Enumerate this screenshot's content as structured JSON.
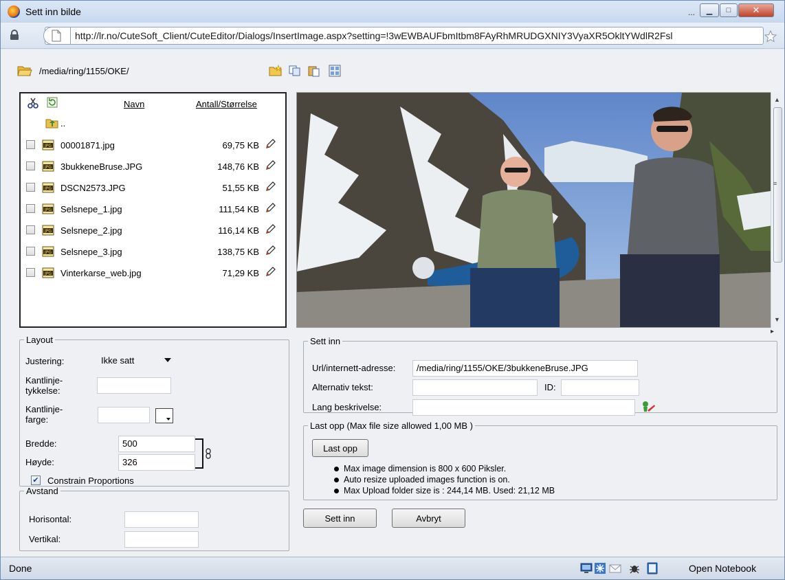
{
  "window": {
    "title": "Sett inn bilde",
    "ellipsis": "..."
  },
  "address": {
    "url": "http://lr.no/CuteSoft_Client/CuteEditor/Dialogs/InsertImage.aspx?setting=!3wEWBAUFbmItbm8FAyRhMRUDGXNIY3VyaXR5OkltYWdlR2Fsl"
  },
  "folder": {
    "path": "/media/ring/1155/OKE/"
  },
  "filelist": {
    "col_name": "Navn",
    "col_size": "Antall/Størrelse",
    "up_label": "..",
    "files": [
      {
        "name": "00001871.jpg",
        "size": "69,75 KB"
      },
      {
        "name": "3bukkeneBruse.JPG",
        "size": "148,76 KB"
      },
      {
        "name": "DSCN2573.JPG",
        "size": "51,55 KB"
      },
      {
        "name": "Selsnepe_1.jpg",
        "size": "111,54 KB"
      },
      {
        "name": "Selsnepe_2.jpg",
        "size": "116,14 KB"
      },
      {
        "name": "Selsnepe_3.jpg",
        "size": "138,75 KB"
      },
      {
        "name": "Vinterkarse_web.jpg",
        "size": "71,29 KB"
      }
    ]
  },
  "layout": {
    "legend": "Layout",
    "align_label": "Justering:",
    "align_value": "Ikke satt",
    "border_width_label_1": "Kantlinje-",
    "border_width_label_2": "tykkelse:",
    "border_width_value": "",
    "border_color_label_1": "Kantlinje-",
    "border_color_label_2": "farge:",
    "border_color_value": "",
    "width_label": "Bredde:",
    "width_value": "500",
    "height_label": "Høyde:",
    "height_value": "326",
    "constrain_label": "Constrain Proportions",
    "constrain_checked": true
  },
  "spacing": {
    "legend": "Avstand",
    "horizontal_label": "Horisontal:",
    "horizontal_value": "",
    "vertical_label": "Vertikal:",
    "vertical_value": ""
  },
  "insert": {
    "legend": "Sett inn",
    "url_label": "Url/internett-adresse:",
    "url_value": "/media/ring/1155/OKE/3bukkeneBruse.JPG",
    "alt_label": "Alternativ tekst:",
    "alt_value": "",
    "id_label": "ID:",
    "id_value": "",
    "longdesc_label": "Lang beskrivelse:",
    "longdesc_value": ""
  },
  "upload": {
    "legend": "Last opp (Max file size allowed 1,00 MB )",
    "button_label": "Last opp",
    "info": [
      "Max image dimension is 800 x 600 Piksler.",
      "Auto resize uploaded images function is on.",
      "Max Upload folder size is : 244,14 MB. Used: 21,12 MB"
    ]
  },
  "actions": {
    "insert_label": "Sett inn",
    "cancel_label": "Avbryt"
  },
  "status": {
    "text": "Done",
    "notebook": "Open Notebook"
  },
  "colors": {
    "titlebar": "#c7d8ee",
    "window_border": "#6f8db5",
    "close_button": "#c0432b",
    "content_bg": "#eef0f3"
  }
}
